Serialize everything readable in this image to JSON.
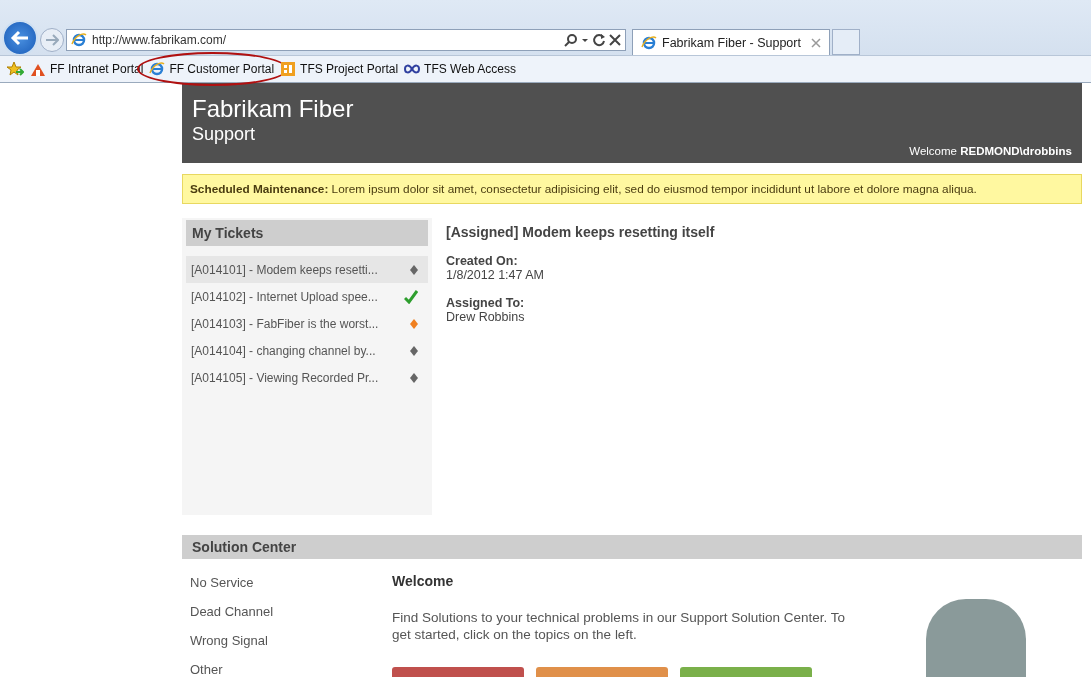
{
  "browser": {
    "address": "http://www.fabrikam.com/",
    "tabs": [
      {
        "title": "Fabrikam Fiber - Support",
        "selected": true
      }
    ],
    "favorites": [
      {
        "label": "FF Intranet Portal",
        "kind": "intranet",
        "circled": false
      },
      {
        "label": "FF Customer Portal",
        "kind": "ie",
        "circled": true
      },
      {
        "label": "TFS Project Portal",
        "kind": "tfs",
        "circled": false
      },
      {
        "label": "TFS Web Access",
        "kind": "web",
        "circled": false
      }
    ]
  },
  "header": {
    "title": "Fabrikam Fiber",
    "subtitle": "Support",
    "welcome": "Welcome",
    "user": "REDMOND\\drobbins"
  },
  "notice": {
    "label": "Scheduled Maintenance:",
    "text": "Lorem ipsum dolor sit amet, consectetur adipisicing elit, sed do eiusmod tempor incididunt ut labore et dolore magna aliqua."
  },
  "tickets": {
    "title": "My Tickets",
    "items": [
      {
        "label": "[A014101] - Modem keeps resetti...",
        "selected": true,
        "kind": "diamond",
        "color": "#666666"
      },
      {
        "label": "[A014102] - Internet Upload spee...",
        "selected": false,
        "kind": "check",
        "color": "#2e9e2e"
      },
      {
        "label": "[A014103] - FabFiber is the worst...",
        "selected": false,
        "kind": "diamond",
        "color": "#f08020"
      },
      {
        "label": "[A014104] - changing channel by...",
        "selected": false,
        "kind": "diamond",
        "color": "#666666"
      },
      {
        "label": "[A014105] - Viewing Recorded Pr...",
        "selected": false,
        "kind": "diamond",
        "color": "#666666"
      }
    ]
  },
  "detail": {
    "title": "[Assigned] Modem keeps resetting itself",
    "fields": [
      {
        "label": "Created On:",
        "value": "1/8/2012 1:47 AM"
      },
      {
        "label": "Assigned To:",
        "value": "Drew Robbins"
      }
    ]
  },
  "solution_center": {
    "title": "Solution Center",
    "topics": [
      "No Service",
      "Dead Channel",
      "Wrong Signal",
      "Other"
    ],
    "heading": "Welcome",
    "text": "Find Solutions to your technical problems in our Support Solution Center. To get started, click on the topics on the left.",
    "buttons": [
      {
        "color": "#c0504d"
      },
      {
        "color": "#e0904a"
      },
      {
        "color": "#7ab04a"
      }
    ]
  }
}
